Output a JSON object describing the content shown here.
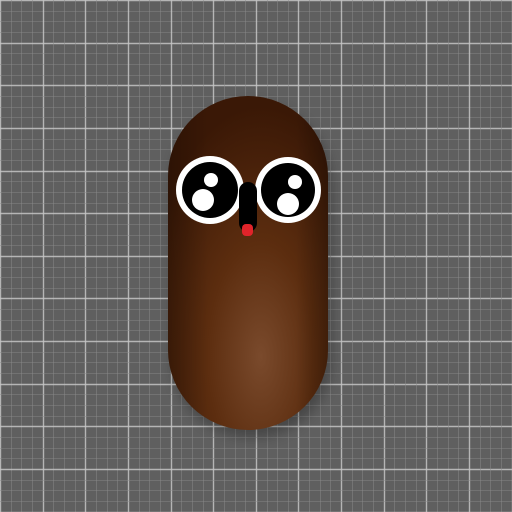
{
  "scene": {
    "background_color": "#5f5f5f",
    "grid": {
      "visible": true,
      "minor_line_color": "#8a8a8a",
      "major_line_color": "#c4c4c4"
    },
    "character": {
      "shape": "capsule",
      "body_color": "#5c2d0f",
      "body_highlight_color": "#7a4a2c",
      "body_shadow_color": "#3a1806",
      "eye_count": 2,
      "eye_white_color": "#ffffff",
      "eye_ring_color": "#000000",
      "mouth_color": "#000000",
      "tongue_color": "#e0242a"
    }
  }
}
